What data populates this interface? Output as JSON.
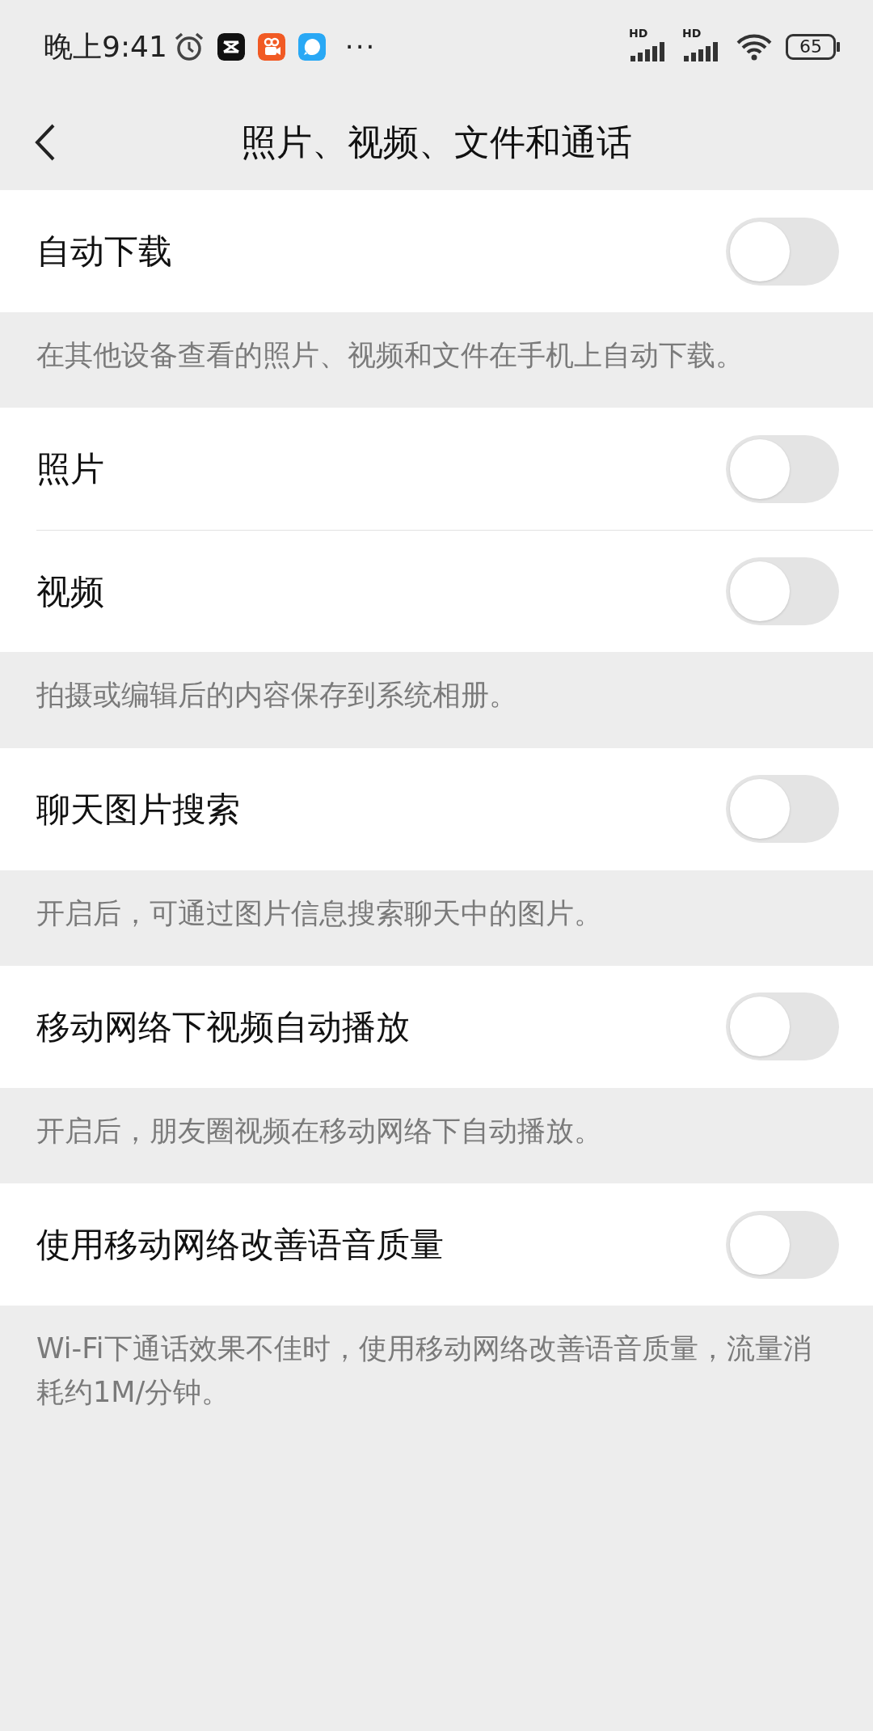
{
  "status_bar": {
    "time": "晚上9:41",
    "more": "···",
    "signals": [
      {
        "label": "HD"
      },
      {
        "label": "HD"
      }
    ],
    "battery": "65"
  },
  "header": {
    "title": "照片、视频、文件和通话"
  },
  "sections": [
    {
      "items": [
        {
          "label": "自动下载",
          "on": false
        }
      ],
      "note": "在其他设备查看的照片、视频和文件在手机上自动下载。"
    },
    {
      "items": [
        {
          "label": "照片",
          "on": false
        },
        {
          "label": "视频",
          "on": false
        }
      ],
      "note": "拍摄或编辑后的内容保存到系统相册。"
    },
    {
      "items": [
        {
          "label": "聊天图片搜索",
          "on": false
        }
      ],
      "note": "开启后，可通过图片信息搜索聊天中的图片。"
    },
    {
      "items": [
        {
          "label": "移动网络下视频自动播放",
          "on": false
        }
      ],
      "note": "开启后，朋友圈视频在移动网络下自动播放。"
    },
    {
      "items": [
        {
          "label": "使用移动网络改善语音质量",
          "on": false
        }
      ],
      "note": "Wi-Fi下通话效果不佳时，使用移动网络改善语音质量，流量消耗约1M/分钟。"
    }
  ]
}
